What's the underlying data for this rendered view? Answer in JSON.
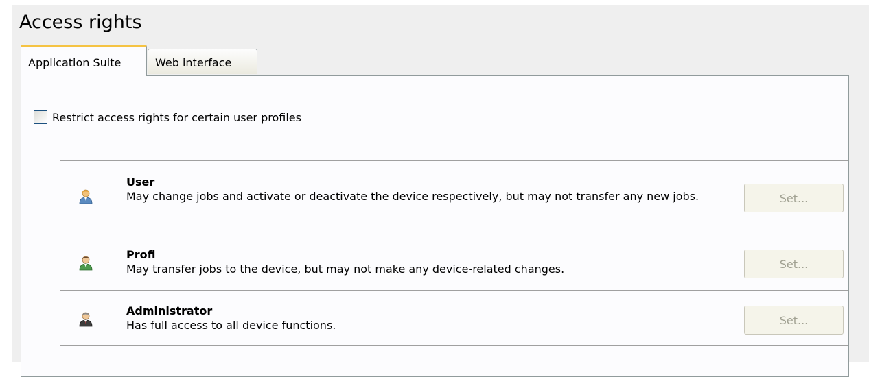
{
  "page": {
    "title": "Access rights"
  },
  "tabs": [
    {
      "label": "Application Suite",
      "active": true
    },
    {
      "label": "Web interface",
      "active": false
    }
  ],
  "restrict": {
    "label": "Restrict access rights for certain user profiles",
    "checked": false
  },
  "profiles": [
    {
      "name": "User",
      "description": "May change jobs and activate or deactivate the device respectively, but may not transfer any new jobs.",
      "icon": "user-icon",
      "button_label": "Set..."
    },
    {
      "name": "Profi",
      "description": "May transfer jobs to the device, but may not make any device-related changes.",
      "icon": "profi-user-icon",
      "button_label": "Set..."
    },
    {
      "name": "Administrator",
      "description": "Has full access to all device functions.",
      "icon": "administrator-icon",
      "button_label": "Set..."
    }
  ],
  "colors": {
    "tab_highlight": "#f5c343",
    "panel_border": "#919b9c",
    "disabled_text": "#a1a192",
    "user_icon": "#e8a53a",
    "profi_icon": "#4e9a4e",
    "admin_icon": "#4a4a4a"
  }
}
